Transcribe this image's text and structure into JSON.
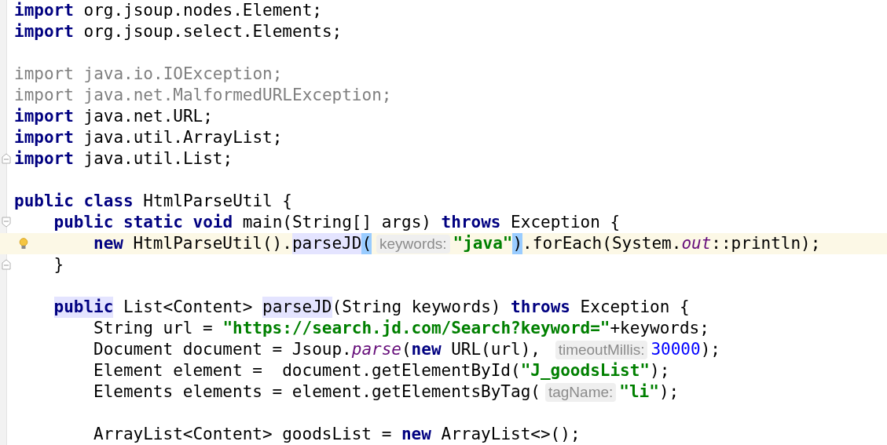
{
  "editor": {
    "lines": [
      {
        "kind": "code",
        "tokens": [
          {
            "kind": "kw",
            "text": "import"
          },
          {
            "kind": "plain",
            "text": " org.jsoup.nodes.Element;"
          }
        ]
      },
      {
        "kind": "code",
        "tokens": [
          {
            "kind": "kw",
            "text": "import"
          },
          {
            "kind": "plain",
            "text": " org.jsoup.select.Elements;"
          }
        ]
      },
      {
        "kind": "blank"
      },
      {
        "kind": "code",
        "tokens": [
          {
            "kind": "unused",
            "text": "import java.io.IOException;"
          }
        ]
      },
      {
        "kind": "code",
        "tokens": [
          {
            "kind": "unused",
            "text": "import java.net.MalformedURLException;"
          }
        ]
      },
      {
        "kind": "code",
        "tokens": [
          {
            "kind": "kw",
            "text": "import"
          },
          {
            "kind": "plain",
            "text": " java.net.URL;"
          }
        ]
      },
      {
        "kind": "code",
        "tokens": [
          {
            "kind": "kw",
            "text": "import"
          },
          {
            "kind": "plain",
            "text": " java.util.ArrayList;"
          }
        ]
      },
      {
        "kind": "code",
        "gutter": {
          "kind": "fold-end"
        },
        "tokens": [
          {
            "kind": "kw",
            "text": "import"
          },
          {
            "kind": "plain",
            "text": " java.util.List;"
          }
        ]
      },
      {
        "kind": "blank"
      },
      {
        "kind": "code",
        "tokens": [
          {
            "kind": "kw",
            "text": "public class"
          },
          {
            "kind": "plain",
            "text": " HtmlParseUtil {"
          }
        ],
        "children": [
          {
            "kind": "code",
            "gutter": {
              "kind": "fold-start"
            },
            "tokens": [
              {
                "kind": "kw",
                "text": "public static void"
              },
              {
                "kind": "plain",
                "text": " main(String[] args) "
              },
              {
                "kind": "kw",
                "text": "throws"
              },
              {
                "kind": "plain",
                "text": " Exception {"
              }
            ],
            "children": [
              {
                "kind": "code",
                "gutter": {
                  "kind": "bulb"
                },
                "current": true,
                "tokens": [
                  {
                    "kind": "kw",
                    "text": "new"
                  },
                  {
                    "kind": "plain",
                    "text": " HtmlParseUtil()."
                  },
                  {
                    "kind": "plain",
                    "text": "parseJD",
                    "highlighted": true
                  },
                  {
                    "kind": "brace",
                    "text": "(",
                    "highlighted": true
                  },
                  {
                    "kind": "hint",
                    "text": "keywords:"
                  },
                  {
                    "kind": "str",
                    "text": "\"java\""
                  },
                  {
                    "kind": "brace",
                    "text": ")",
                    "highlighted": true
                  },
                  {
                    "kind": "plain",
                    "text": ".forEach(System."
                  },
                  {
                    "kind": "static",
                    "text": "out"
                  },
                  {
                    "kind": "plain",
                    "text": "::println);"
                  }
                ]
              }
            ]
          },
          {
            "kind": "code",
            "gutter": {
              "kind": "fold-end"
            },
            "tokens": [
              {
                "kind": "plain",
                "text": "}"
              }
            ]
          },
          {
            "kind": "blank"
          },
          {
            "kind": "code",
            "tokens": [
              {
                "kind": "kw",
                "text": "public",
                "highlighted": true
              },
              {
                "kind": "plain",
                "text": " List<Content> "
              },
              {
                "kind": "plain",
                "text": "parseJD",
                "highlighted": true
              },
              {
                "kind": "plain",
                "text": "(String keywords) "
              },
              {
                "kind": "kw",
                "text": "throws"
              },
              {
                "kind": "plain",
                "text": " Exception {"
              }
            ],
            "children": [
              {
                "kind": "code",
                "tokens": [
                  {
                    "kind": "plain",
                    "text": "String url = "
                  },
                  {
                    "kind": "str",
                    "text": "\"https://search.jd.com/Search?keyword=\""
                  },
                  {
                    "kind": "plain",
                    "text": "+keywords;"
                  }
                ]
              },
              {
                "kind": "code",
                "tokens": [
                  {
                    "kind": "plain",
                    "text": "Document document = Jsoup."
                  },
                  {
                    "kind": "static",
                    "text": "parse"
                  },
                  {
                    "kind": "plain",
                    "text": "("
                  },
                  {
                    "kind": "kw",
                    "text": "new"
                  },
                  {
                    "kind": "plain",
                    "text": " URL(url), "
                  },
                  {
                    "kind": "hint",
                    "text": "timeoutMillis:"
                  },
                  {
                    "kind": "num",
                    "text": "30000"
                  },
                  {
                    "kind": "plain",
                    "text": ");"
                  }
                ]
              },
              {
                "kind": "code",
                "tokens": [
                  {
                    "kind": "plain",
                    "text": "Element element =  document.getElementById("
                  },
                  {
                    "kind": "str",
                    "text": "\"J_goodsList\""
                  },
                  {
                    "kind": "plain",
                    "text": ");"
                  }
                ]
              },
              {
                "kind": "code",
                "tokens": [
                  {
                    "kind": "plain",
                    "text": "Elements elements = element.getElementsByTag("
                  },
                  {
                    "kind": "hint",
                    "text": "tagName:"
                  },
                  {
                    "kind": "str",
                    "text": "\"li\""
                  },
                  {
                    "kind": "plain",
                    "text": ");"
                  }
                ]
              },
              {
                "kind": "blank"
              },
              {
                "kind": "code",
                "tokens": [
                  {
                    "kind": "plain",
                    "text": "ArrayList<Content> goodsList = "
                  },
                  {
                    "kind": "kw",
                    "text": "new"
                  },
                  {
                    "kind": "plain",
                    "text": " ArrayList<>();"
                  }
                ]
              }
            ]
          }
        ]
      }
    ]
  }
}
